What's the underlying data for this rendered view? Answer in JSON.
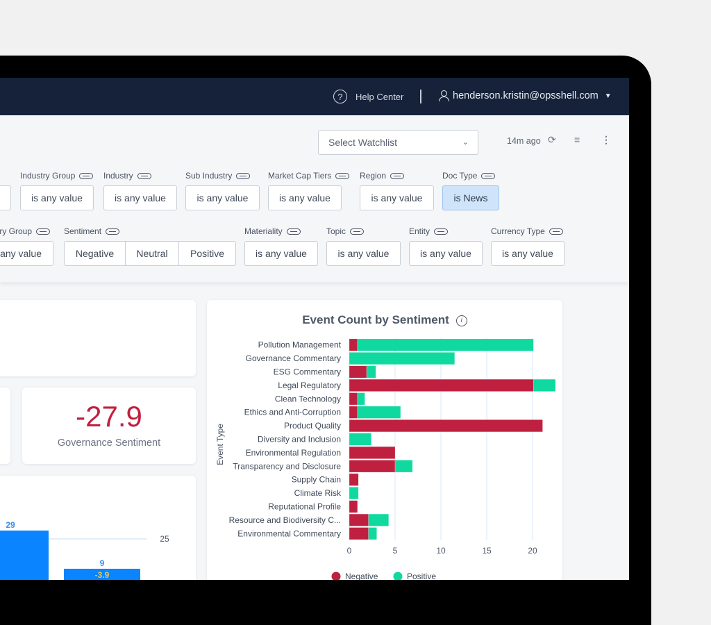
{
  "header": {
    "help_label": "Help Center",
    "help_icon": "?",
    "user_email": "henderson.kristin@opsshell.com",
    "user_chevron": "⌄"
  },
  "toolbar": {
    "watchlist_placeholder": "Select Watchlist",
    "updated": "14m ago",
    "refresh_icon": "⟳",
    "filter_icon": "≡",
    "more_icon": "⋮"
  },
  "filters_row1": [
    {
      "label": "Industry Group",
      "value": "is any value"
    },
    {
      "label": "Industry",
      "value": "is any value"
    },
    {
      "label": "Sub Industry",
      "value": "is any value"
    },
    {
      "label": "Market Cap Tiers",
      "value": "is any value"
    },
    {
      "label": "Region",
      "value": "is any value"
    },
    {
      "label": "Doc Type",
      "value": "is News"
    }
  ],
  "filters_row2": [
    {
      "label": "try Group",
      "value": "any value"
    },
    {
      "label": "Sentiment",
      "options": [
        "Negative",
        "Neutral",
        "Positive"
      ]
    },
    {
      "label": "Materiality",
      "value": "is any value"
    },
    {
      "label": "Topic",
      "value": "is any value"
    },
    {
      "label": "Entity",
      "value": "is any value"
    },
    {
      "label": "Currency Type",
      "value": "is any value"
    }
  ],
  "kpi": {
    "value": "-27.9",
    "caption": "Governance Sentiment"
  },
  "left_chart": {
    "bar1_label": "29",
    "bar2_label": "9",
    "bar2_inner_label": "-3.9",
    "ref_line_label": "25"
  },
  "colors": {
    "negative": "#c0203f",
    "positive": "#10d9a0",
    "bar_blue": "#0a84ff",
    "header": "#15223a"
  },
  "chart_data": {
    "type": "bar",
    "orientation": "horizontal",
    "stacked": true,
    "title": "Event Count by Sentiment",
    "xlabel": "",
    "ylabel": "Event Type",
    "xlim": [
      0,
      23
    ],
    "xticks": [
      0,
      5,
      10,
      15,
      20
    ],
    "grid": true,
    "legend_position": "bottom",
    "categories": [
      "Pollution Management",
      "Governance Commentary",
      "ESG Commentary",
      "Legal Regulatory",
      "Clean Technology",
      "Ethics and Anti-Corruption",
      "Product Quality",
      "Diversity and Inclusion",
      "Environmental Regulation",
      "Transparency and Disclosure",
      "Supply Chain",
      "Climate Risk",
      "Reputational Profile",
      "Resource and Biodiversity C...",
      "Environmental Commentary"
    ],
    "series": [
      {
        "name": "Negative",
        "values": [
          0.9,
          0,
          1.9,
          20.1,
          0.9,
          0.9,
          21.1,
          0,
          5.0,
          5.0,
          1.0,
          0,
          0.9,
          2.1,
          2.1
        ]
      },
      {
        "name": "Positive",
        "values": [
          19.2,
          11.5,
          1.0,
          2.4,
          0.8,
          4.7,
          0,
          2.4,
          0,
          1.9,
          0,
          1.0,
          0,
          2.2,
          0.9
        ]
      }
    ]
  }
}
